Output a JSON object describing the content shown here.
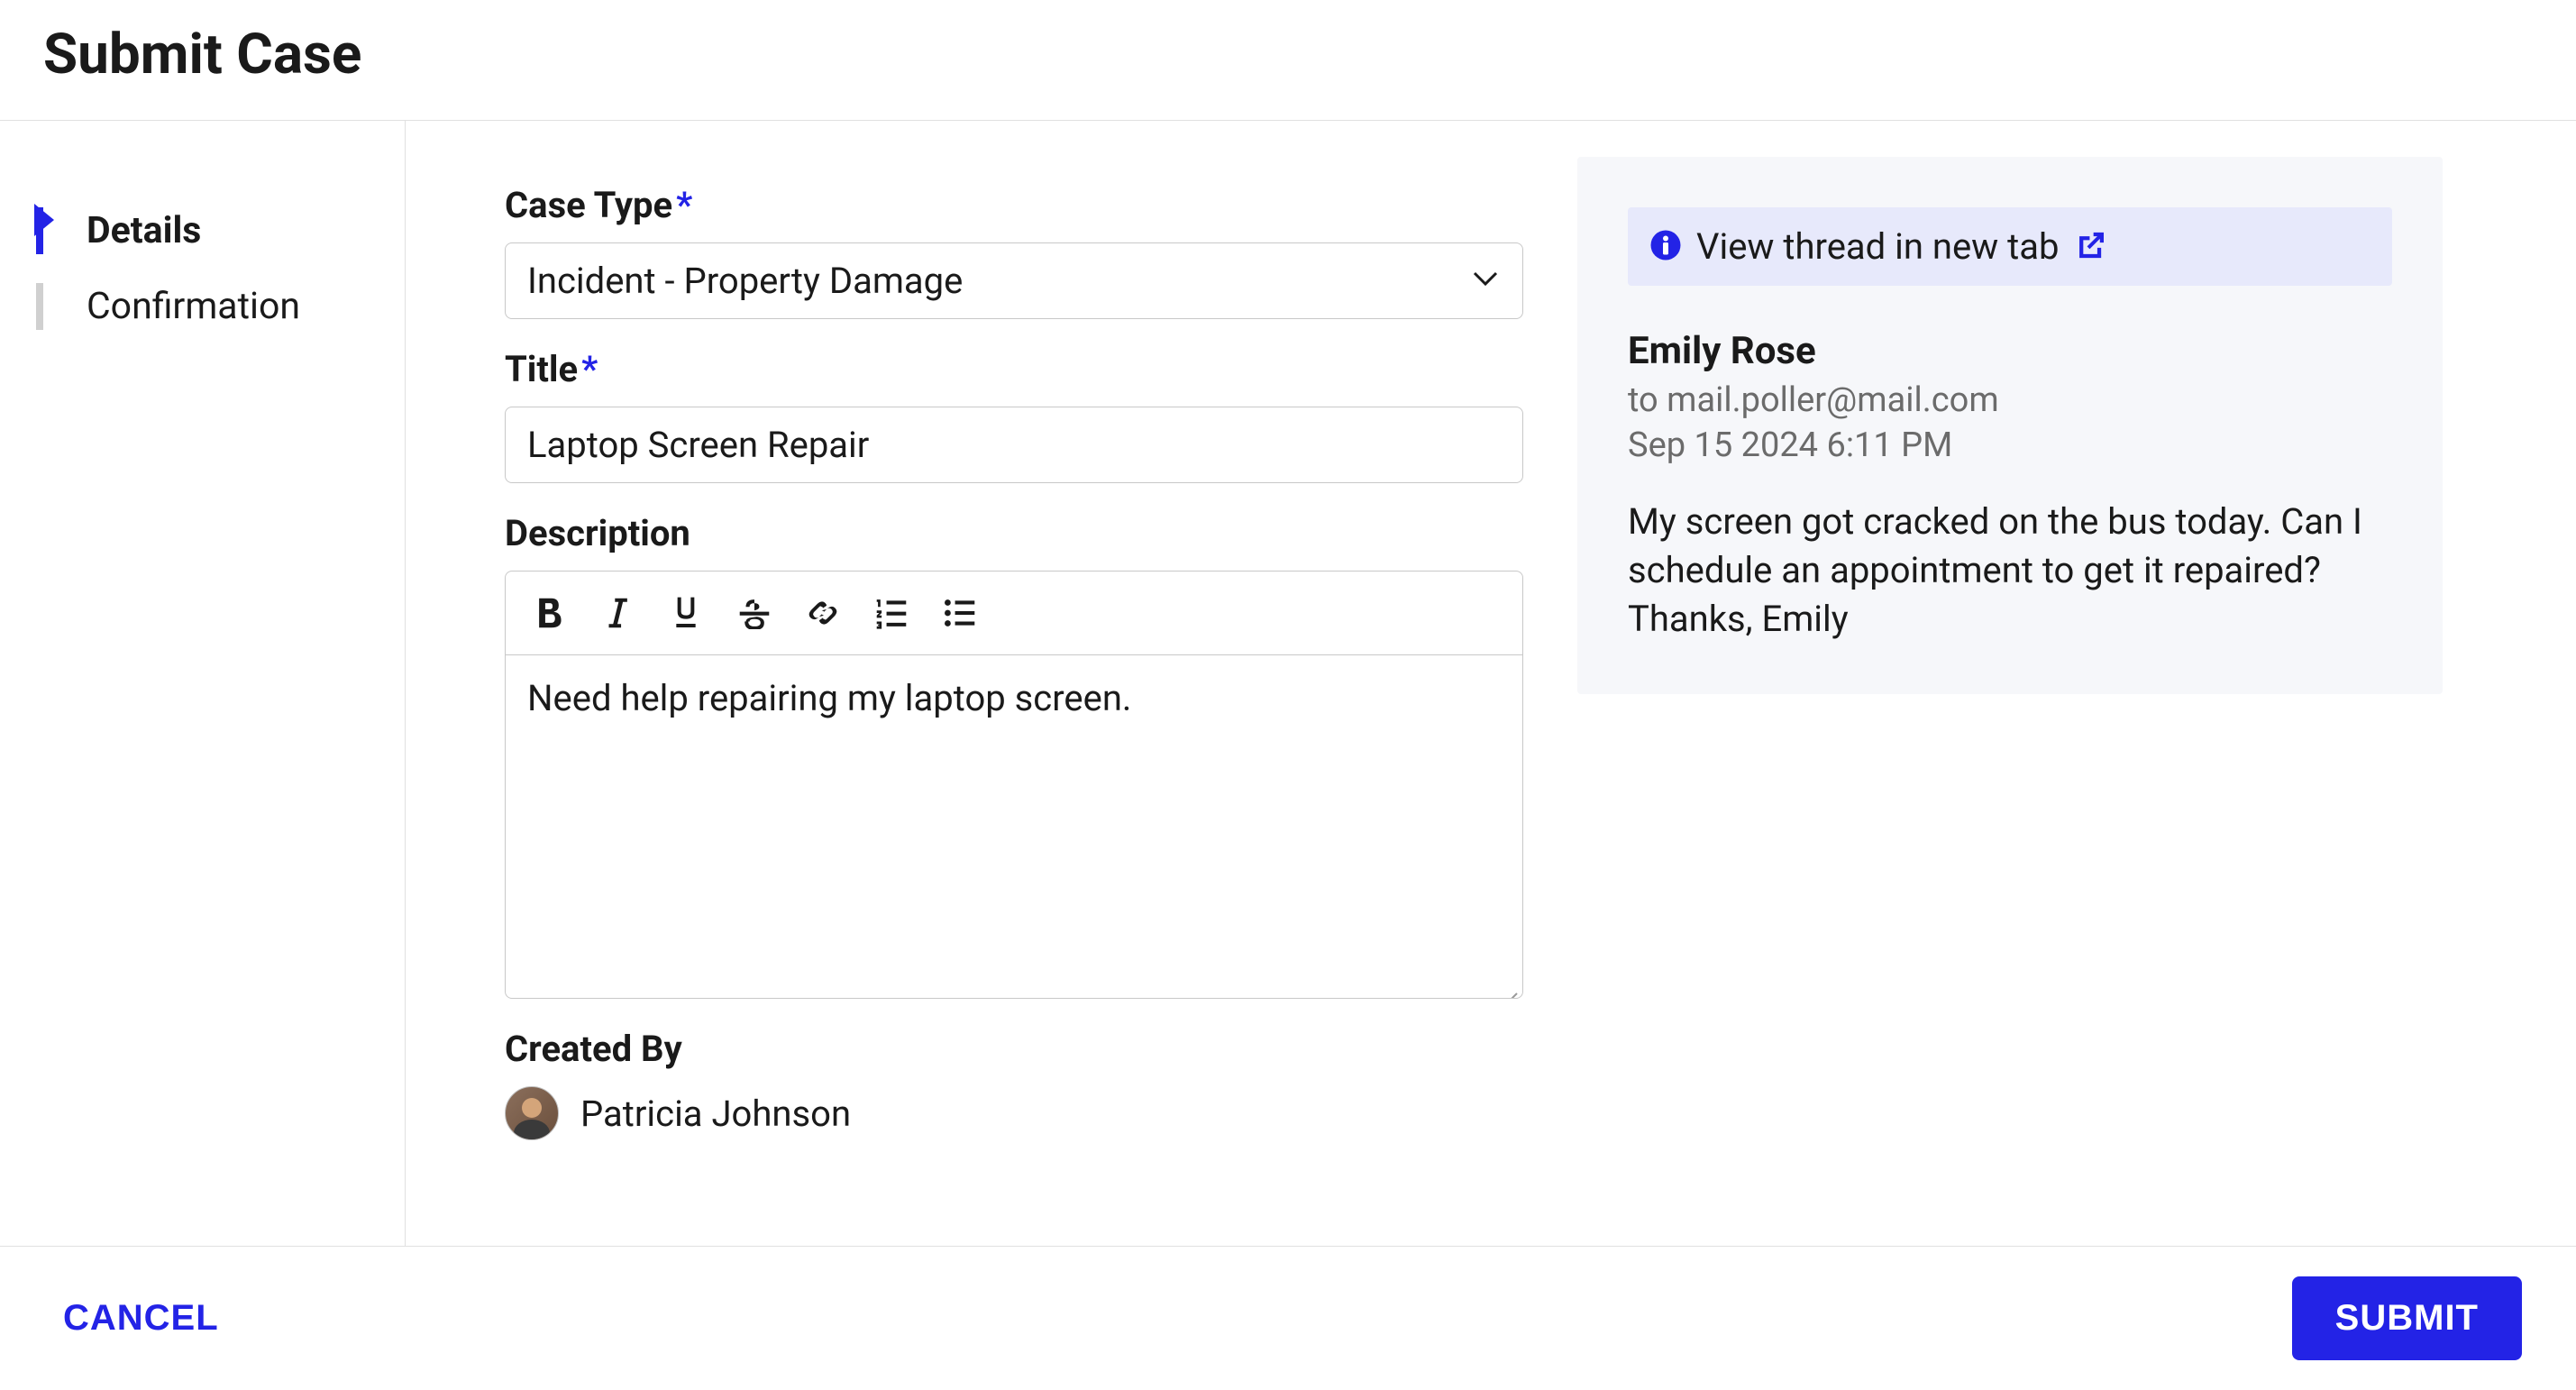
{
  "page": {
    "title": "Submit Case"
  },
  "sidebar": {
    "steps": [
      {
        "label": "Details",
        "active": true
      },
      {
        "label": "Confirmation",
        "active": false
      }
    ]
  },
  "form": {
    "caseType": {
      "label": "Case Type",
      "value": "Incident - Property Damage",
      "required": true
    },
    "title": {
      "label": "Title",
      "value": "Laptop Screen Repair",
      "required": true
    },
    "description": {
      "label": "Description",
      "value": "Need help repairing my laptop screen."
    },
    "createdBy": {
      "label": "Created By",
      "name": "Patricia Johnson"
    }
  },
  "emailPanel": {
    "bannerText": "View thread in new tab",
    "senderName": "Emily Rose",
    "to": "to mail.poller@mail.com",
    "date": "Sep 15 2024 6:11 PM",
    "body": "My screen got cracked on the bus today. Can I schedule an appointment to get it repaired? Thanks, Emily"
  },
  "footer": {
    "cancelLabel": "CANCEL",
    "submitLabel": "SUBMIT"
  }
}
